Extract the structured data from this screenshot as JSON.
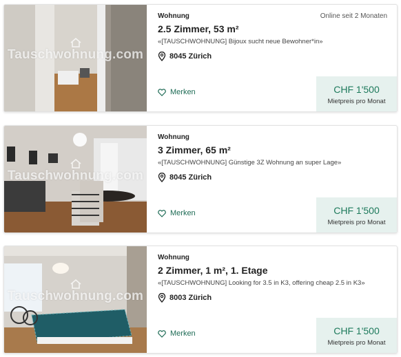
{
  "watermark": "Tauschwohnung.com",
  "listings": [
    {
      "type": "Wohnung",
      "online": "Online seit 2 Monaten",
      "title": "2.5 Zimmer, 53 m²",
      "description": "«[TAUSCHWOHNUNG] Bijoux sucht neue Bewohner*in»",
      "location": "8045 Zürich",
      "save_label": "Merken",
      "price": "CHF 1'500",
      "price_label": "Mietpreis pro Monat"
    },
    {
      "type": "Wohnung",
      "title": "3 Zimmer, 65 m²",
      "description": "«[TAUSCHWOHNUNG] Günstige 3Z Wohnung an super Lage»",
      "location": "8045 Zürich",
      "save_label": "Merken",
      "price": "CHF 1'500",
      "price_label": "Mietpreis pro Monat"
    },
    {
      "type": "Wohnung",
      "title": "2 Zimmer, 1 m², 1. Etage",
      "description": "«[TAUSCHWOHNUNG] Looking for 3.5 in K3, offering cheap 2.5 in K3»",
      "location": "8003 Zürich",
      "save_label": "Merken",
      "price": "CHF 1'500",
      "price_label": "Mietpreis pro Monat"
    }
  ],
  "colors": {
    "accent": "#1e7a5c",
    "price_bg": "#e6f1ee"
  },
  "icons": {
    "location": "map-pin-icon",
    "save": "heart-outline-icon"
  }
}
